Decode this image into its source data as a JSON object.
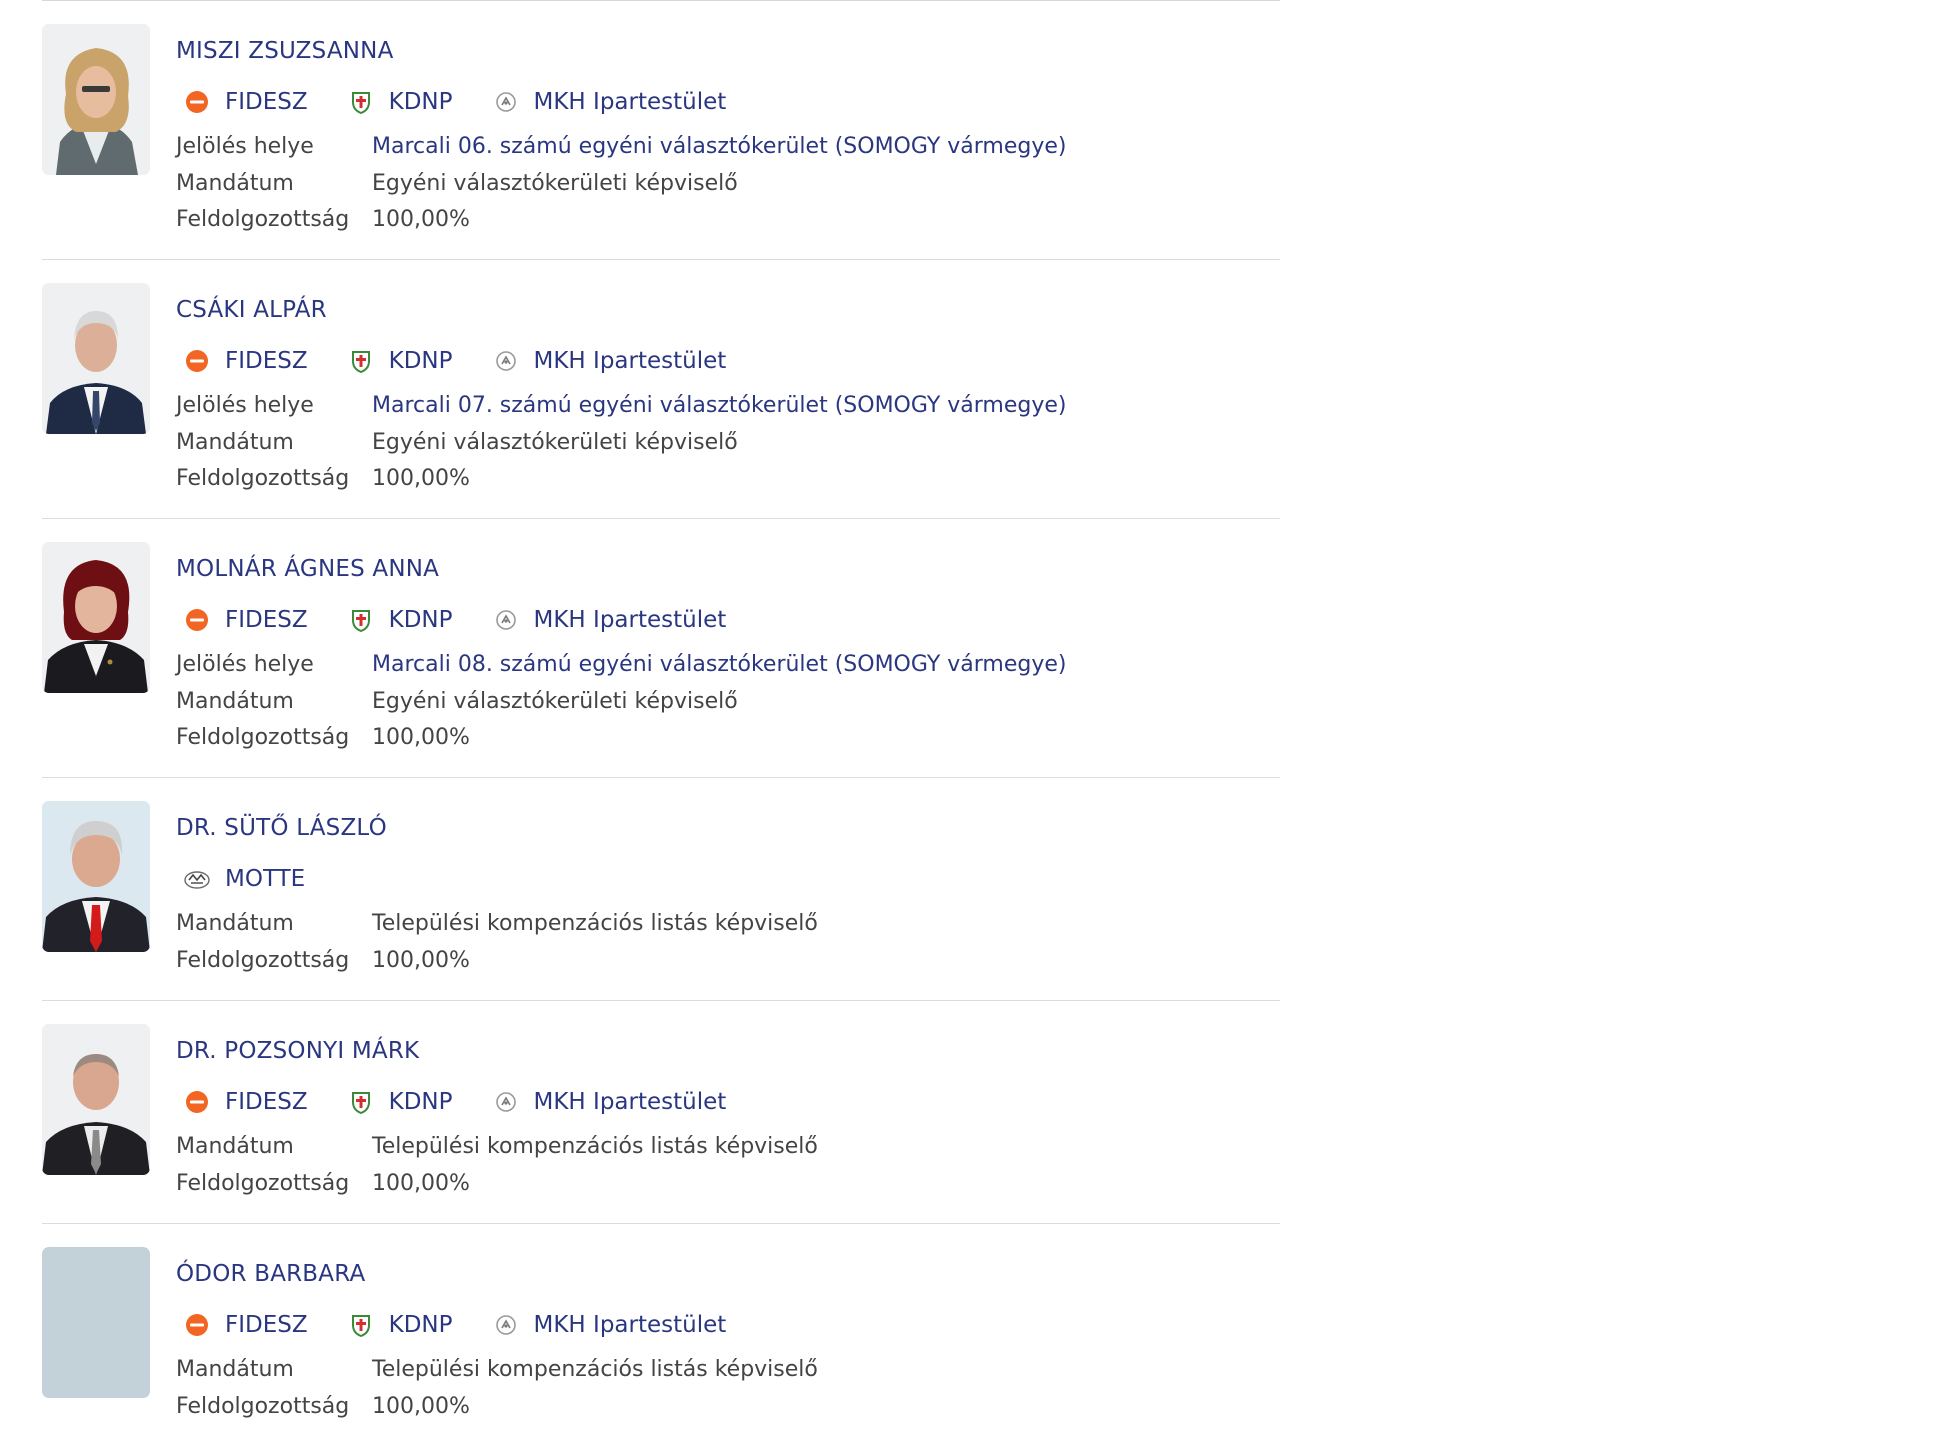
{
  "labels": {
    "jeloles": "Jelölés helye",
    "mandatum": "Mandátum",
    "feldolgozottsag": "Feldolgozottság"
  },
  "colors": {
    "name_link": "#2a3780",
    "fidesz_orange": "#f26522",
    "kdnp_green": "#3a8a3a",
    "kdnp_red": "#d32f2f",
    "placeholder_photo": "#c3d2d9"
  },
  "candidates": [
    {
      "name": "MISZI ZSUZSANNA",
      "parties": [
        {
          "name": "FIDESZ",
          "icon": "fidesz-logo-icon"
        },
        {
          "name": "KDNP",
          "icon": "kdnp-logo-icon"
        },
        {
          "name": "MKH Ipartestület",
          "icon": "mkh-logo-icon"
        }
      ],
      "jeloles": "Marcali 06. számú egyéni választókerület (SOMOGY vármegye)",
      "mandatum": "Egyéni választókerületi képviselő",
      "feldolgozottsag": "100,00%"
    },
    {
      "name": "CSÁKI ALPÁR",
      "parties": [
        {
          "name": "FIDESZ",
          "icon": "fidesz-logo-icon"
        },
        {
          "name": "KDNP",
          "icon": "kdnp-logo-icon"
        },
        {
          "name": "MKH Ipartestület",
          "icon": "mkh-logo-icon"
        }
      ],
      "jeloles": "Marcali 07. számú egyéni választókerület (SOMOGY vármegye)",
      "mandatum": "Egyéni választókerületi képviselő",
      "feldolgozottsag": "100,00%"
    },
    {
      "name": "MOLNÁR ÁGNES ANNA",
      "parties": [
        {
          "name": "FIDESZ",
          "icon": "fidesz-logo-icon"
        },
        {
          "name": "KDNP",
          "icon": "kdnp-logo-icon"
        },
        {
          "name": "MKH Ipartestület",
          "icon": "mkh-logo-icon"
        }
      ],
      "jeloles": "Marcali 08. számú egyéni választókerület (SOMOGY vármegye)",
      "mandatum": "Egyéni választókerületi képviselő",
      "feldolgozottsag": "100,00%"
    },
    {
      "name": "DR. SÜTŐ LÁSZLÓ",
      "parties": [
        {
          "name": "MOTTE",
          "icon": "motte-logo-icon"
        }
      ],
      "mandatum": "Települési kompenzációs listás képviselő",
      "feldolgozottsag": "100,00%"
    },
    {
      "name": "DR. POZSONYI MÁRK",
      "parties": [
        {
          "name": "FIDESZ",
          "icon": "fidesz-logo-icon"
        },
        {
          "name": "KDNP",
          "icon": "kdnp-logo-icon"
        },
        {
          "name": "MKH Ipartestület",
          "icon": "mkh-logo-icon"
        }
      ],
      "mandatum": "Települési kompenzációs listás képviselő",
      "feldolgozottsag": "100,00%"
    },
    {
      "name": "ÓDOR BARBARA",
      "parties": [
        {
          "name": "FIDESZ",
          "icon": "fidesz-logo-icon"
        },
        {
          "name": "KDNP",
          "icon": "kdnp-logo-icon"
        },
        {
          "name": "MKH Ipartestület",
          "icon": "mkh-logo-icon"
        }
      ],
      "mandatum": "Települési kompenzációs listás képviselő",
      "feldolgozottsag": "100,00%"
    }
  ]
}
